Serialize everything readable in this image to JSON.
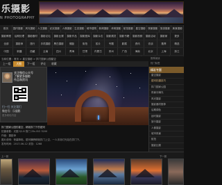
{
  "site": {
    "logo_text": "乐摄影",
    "logo_sub": "N PHOTOGRAPHY"
  },
  "nav": {
    "rows": [
      [
        "首页",
        "国内摄影",
        "风光摄影",
        "人文摄影",
        "纪实摄影",
        "人像摄影",
        "生态摄影",
        "城市建筑",
        "新闻摄影",
        "体育摄影",
        "航拍摄影",
        "星空摄影",
        "夜景摄影",
        "旅游摄影",
        "美食摄影"
      ],
      [
        "摄影教程",
        "后期处理",
        "摄影器材",
        "摄影论坛",
        "摄影比赛",
        "摄影作品",
        "摄影图库",
        "摄影杂志",
        "摄影展览",
        "摄影书籍",
        "摄影视频",
        "摄影活动",
        "摄影家",
        "更多"
      ],
      [
        "全部",
        "摄影师",
        "旅行",
        "手机摄影",
        "黑白摄影",
        "微距",
        "街拍",
        "胶片",
        "专题",
        "影展",
        "资讯",
        "访谈",
        "推荐",
        "精选"
      ],
      [
        "中国",
        "新疆",
        "西藏",
        "云南",
        "四川",
        "青海",
        "甘肃",
        "内蒙古",
        "贵州",
        "广西",
        "海南",
        "北京",
        "上海",
        "浙江"
      ],
      [
        "国外",
        "美国",
        "冰岛",
        "挪威",
        "瑞士",
        "日本",
        "新西兰",
        "澳洲",
        "加拿大",
        "非洲",
        "南极",
        "欧洲",
        "更多"
      ]
    ]
  },
  "breadcrumb": "当前位置：首页 > 星空摄影 > 拱门国家公园星空",
  "album_tabs": [
    "上一组",
    "大图",
    "下一组",
    "评论",
    "收藏"
  ],
  "left_panel": {
    "qr_text": "关注微信公众号\n了解更多摄影\n作品和资讯",
    "caption": "扫一扫 关注我们",
    "caption2": "微信号：乐摄影",
    "small": "更多精彩内容"
  },
  "right_top": [
    "推荐阅读",
    "热门标签"
  ],
  "right_panel": {
    "title": "精彩专题",
    "items": [
      "星空摄影",
      "银河拍摄技巧",
      "拱门国家公园",
      "夜景长曝光",
      "风光摄影",
      "摄影器材推荐",
      "后期调色",
      "延时摄影",
      "旅行摄影",
      "人像摄影",
      "城市夜景",
      "航拍",
      "摄影比赛"
    ]
  },
  "caption_lines": [
    "拱门国家公园的星空，精致拱门下的银河",
    "拍摄参数：光圈 f/2.8 快门 25s ISO 3200",
    "作者：摄影师",
    "图片说明：夜幕降临，银河横跨精致拱门上空，一人手持灯光站在拱门下。",
    "发布时间：2017-06-12 浏览：1268"
  ],
  "thumb_labels": [
    "上一张",
    "下一张"
  ]
}
